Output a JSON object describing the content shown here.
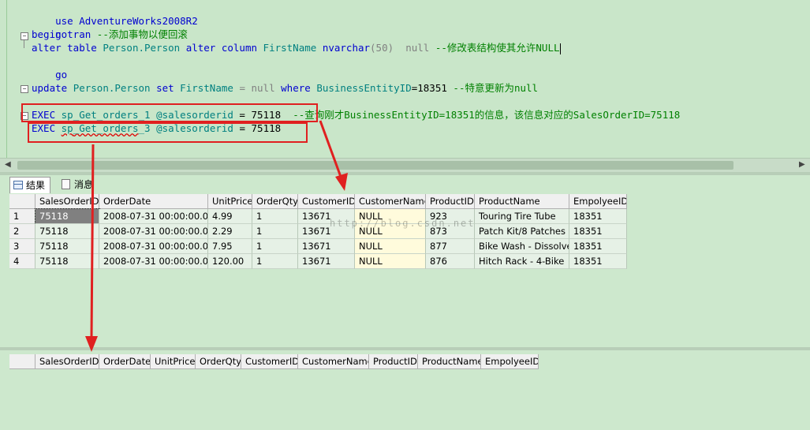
{
  "editor": {
    "lines": {
      "l1": "use AdventureWorks2008R2",
      "l2": "go",
      "l3_kw": "begin tran",
      "l3_cmt": " --添加事物以便回滚",
      "l4_alter": "alter table",
      "l4_obj": "Person.Person",
      "l4_alter2": "alter column",
      "l4_col": "FirstName",
      "l4_type": "nvarchar",
      "l4_len": "(50)",
      "l4_null": "null",
      "l4_cmt": " --修改表结构使其允许NULL",
      "l5": "go",
      "l6_kw": "update",
      "l6_obj": "Person.Person",
      "l6_set": "set",
      "l6_col": "FirstName",
      "l6_eq": "=",
      "l6_null": "null",
      "l6_where": "where",
      "l6_col2": "BusinessEntityID",
      "l6_val": "=18351",
      "l6_cmt": " --特意更新为null",
      "l7_exec": "EXEC",
      "l7_proc": "sp_Get_orders_1",
      "l7_param": "@salesorderid",
      "l7_val": " = 75118",
      "l7_cmt": "--查询刚才BusinessEntityID=18351的信息，该信息对应的SalesOrderID=75118",
      "l8_exec": "EXEC",
      "l8_proc_a": "sp",
      "l8_proc_b": "_Get_orders",
      "l8_proc_c": "_3",
      "l8_param": "@salesorderid",
      "l8_val": " = 75118"
    }
  },
  "tabs": {
    "results": "结果",
    "messages": "消息"
  },
  "grid1": {
    "headers": [
      "SalesOrderID",
      "OrderDate",
      "UnitPrice",
      "OrderQty",
      "CustomerID",
      "CustomerName",
      "ProductID",
      "ProductName",
      "EmpolyeeID"
    ],
    "rows": [
      [
        "1",
        "75118",
        "2008-07-31 00:00:00.000",
        "4.99",
        "1",
        "13671",
        "NULL",
        "923",
        "Touring Tire Tube",
        "18351"
      ],
      [
        "2",
        "75118",
        "2008-07-31 00:00:00.000",
        "2.29",
        "1",
        "13671",
        "NULL",
        "873",
        "Patch Kit/8 Patches",
        "18351"
      ],
      [
        "3",
        "75118",
        "2008-07-31 00:00:00.000",
        "7.95",
        "1",
        "13671",
        "NULL",
        "877",
        "Bike Wash - Dissolver",
        "18351"
      ],
      [
        "4",
        "75118",
        "2008-07-31 00:00:00.000",
        "120.00",
        "1",
        "13671",
        "NULL",
        "876",
        "Hitch Rack - 4-Bike",
        "18351"
      ]
    ]
  },
  "grid2": {
    "headers": [
      "SalesOrderID",
      "OrderDate",
      "UnitPrice",
      "OrderQty",
      "CustomerID",
      "CustomerName",
      "ProductID",
      "ProductName",
      "EmpolyeeID"
    ]
  },
  "watermark": "http://blog.csdn.net"
}
